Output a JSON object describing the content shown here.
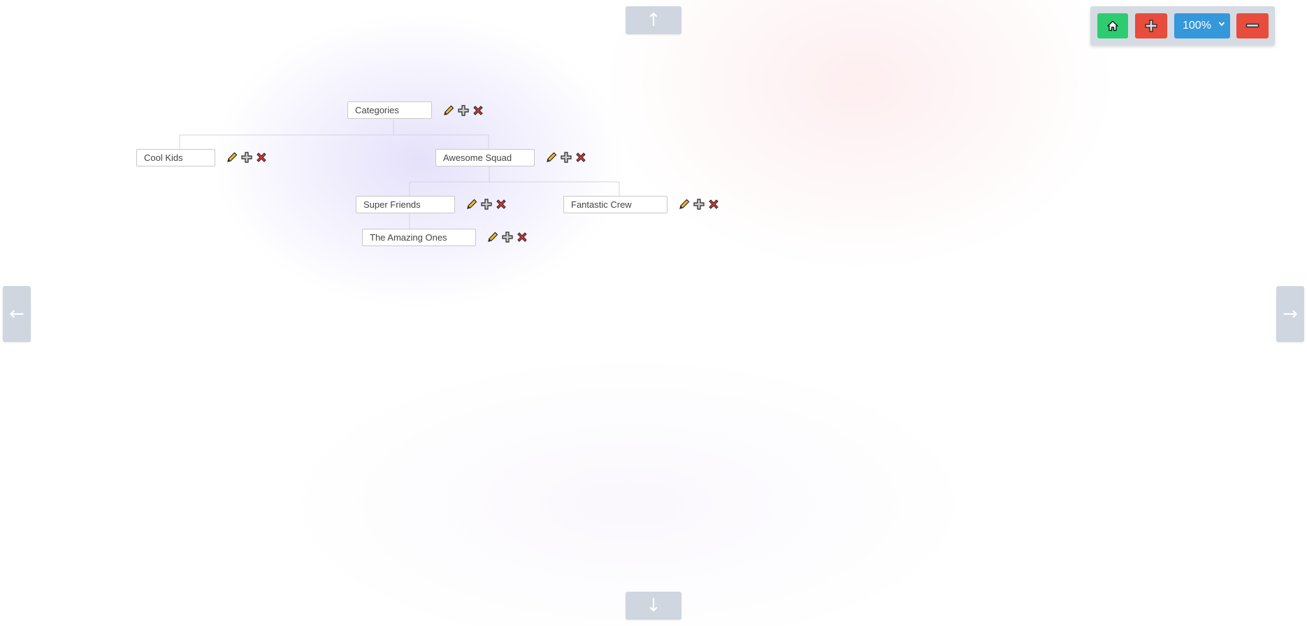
{
  "navigation": {
    "up": "↑",
    "down": "↓",
    "left": "←",
    "right": "→"
  },
  "toolbar": {
    "home_icon": "home-icon",
    "add_icon": "plus-icon",
    "zoom": {
      "selected": "100%",
      "chevron": "⌄"
    },
    "remove_icon": "minus-icon",
    "colors": {
      "home": "#2ecc71",
      "add": "#e74c3c",
      "zoom": "#3498db",
      "remove": "#e74c3c"
    }
  },
  "tree": {
    "root": "Categories",
    "nodes": {
      "cool_kids": "Cool Kids",
      "awesome_squad": "Awesome Squad",
      "super_friends": "Super Friends",
      "fantastic_crew": "Fantastic Crew",
      "the_amazing_ones": "The Amazing Ones"
    },
    "node_actions": [
      "edit-icon",
      "add-icon",
      "delete-icon"
    ]
  }
}
